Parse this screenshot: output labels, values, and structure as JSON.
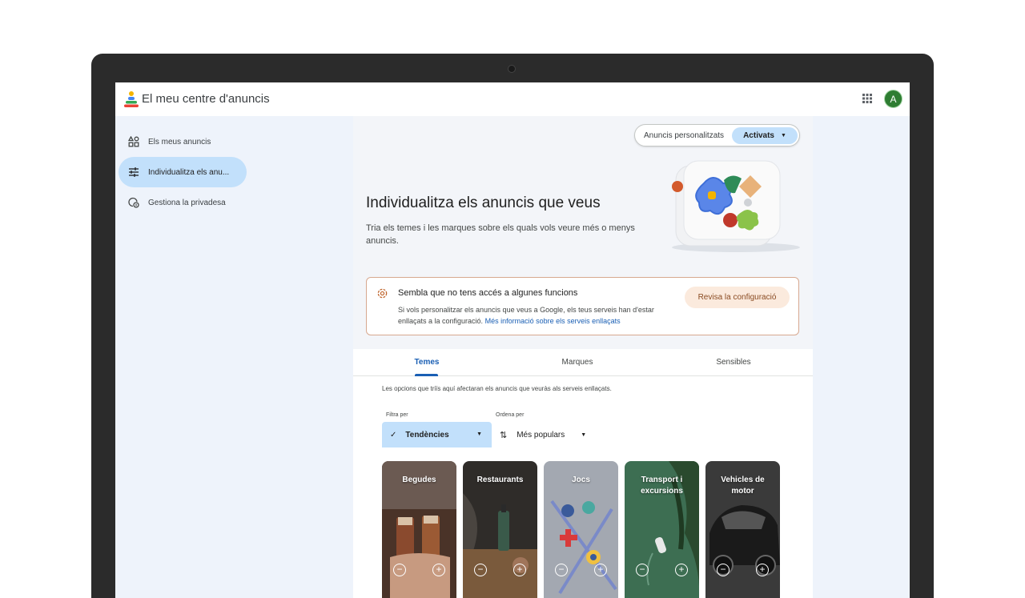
{
  "header": {
    "title": "El meu centre d'anuncis",
    "avatar_letter": "A"
  },
  "sidebar": {
    "items": [
      {
        "label": "Els meus anuncis",
        "icon": "ads-grid-icon",
        "active": false
      },
      {
        "label": "Individualitza els anu...",
        "icon": "tune-sliders-icon",
        "active": true
      },
      {
        "label": "Gestiona la privadesa",
        "icon": "privacy-shield-icon",
        "active": false
      }
    ]
  },
  "personalized": {
    "label": "Anuncis personalitzats",
    "state": "Activats"
  },
  "hero": {
    "title": "Individualitza els anuncis que veus",
    "description": "Tria els temes i les marques sobre els quals vols veure més o menys anuncis."
  },
  "alert": {
    "title": "Sembla que no tens accés a algunes funcions",
    "body": "Si vols personalitzar els anuncis que veus a Google, els teus serveis han d'estar enllaçats a la configuració.",
    "link": "Més informació sobre els serveis enllaçats",
    "button": "Revisa la configuració"
  },
  "tabs": [
    {
      "label": "Temes",
      "active": true
    },
    {
      "label": "Marques",
      "active": false
    },
    {
      "label": "Sensibles",
      "active": false
    }
  ],
  "info_text": "Les opcions que triïs aquí afectaran els anuncis que veuràs als serveis enllaçats.",
  "filter": {
    "label": "Filtra per",
    "value": "Tendències"
  },
  "sort": {
    "label": "Ordena per",
    "value": "Més populars"
  },
  "cards": [
    {
      "title": "Begudes",
      "color": "#5a3a2a"
    },
    {
      "title": "Restaurants",
      "color": "#3a3632"
    },
    {
      "title": "Jocs",
      "color": "#9ea3ad"
    },
    {
      "title": "Transport i excursions",
      "color": "#3f6a4a"
    },
    {
      "title": "Vehicles de motor",
      "color": "#2c2c2c"
    }
  ],
  "colors": {
    "accent": "#1a5fb4",
    "active_bg": "#c2e0fb",
    "alert_border": "#d7a88f",
    "alert_button_bg": "#fbeadd"
  }
}
